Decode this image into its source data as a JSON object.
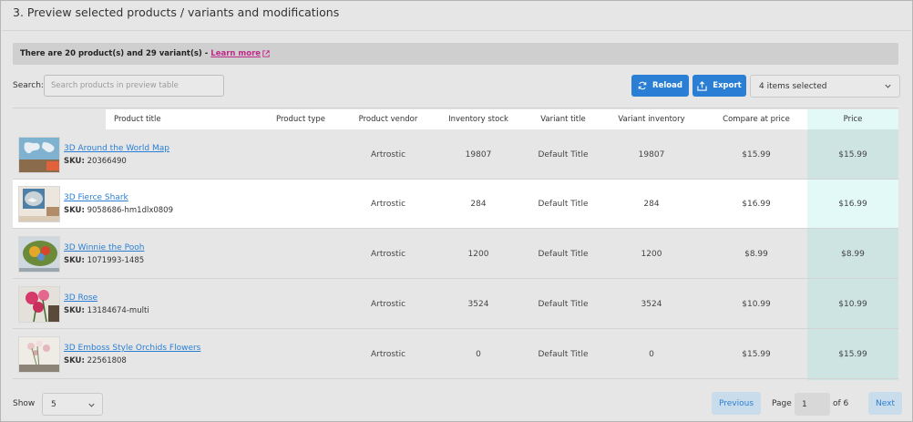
{
  "heading": "3. Preview selected products / variants and modifications",
  "info": {
    "text": "There are 20 product(s) and 29 variant(s) -",
    "learn_more": "Learn more"
  },
  "search": {
    "label": "Search:",
    "placeholder": "Search products in preview table"
  },
  "toolbar": {
    "reload_label": "Reload",
    "export_label": "Export",
    "columns_select": "4 items selected"
  },
  "columns": {
    "product_title": "Product title",
    "product_type": "Product type",
    "product_vendor": "Product vendor",
    "inventory_stock": "Inventory stock",
    "variant_title": "Variant title",
    "variant_inventory": "Variant inventory",
    "compare_at_price": "Compare at price",
    "price": "Price"
  },
  "rows": [
    {
      "title": "3D Around the World Map",
      "sku_label": "SKU:",
      "sku": "20366490",
      "vendor": "Artrostic",
      "stock": "19807",
      "variant": "Default Title",
      "variant_inventory": "19807",
      "compare": "$15.99",
      "price": "$15.99"
    },
    {
      "title": "3D Fierce Shark",
      "sku_label": "SKU:",
      "sku": "9058686-hm1dlx0809",
      "vendor": "Artrostic",
      "stock": "284",
      "variant": "Default Title",
      "variant_inventory": "284",
      "compare": "$16.99",
      "price": "$16.99"
    },
    {
      "title": "3D Winnie the Pooh",
      "sku_label": "SKU:",
      "sku": "1071993-1485",
      "vendor": "Artrostic",
      "stock": "1200",
      "variant": "Default Title",
      "variant_inventory": "1200",
      "compare": "$8.99",
      "price": "$8.99"
    },
    {
      "title": "3D Rose",
      "sku_label": "SKU:",
      "sku": "13184674-multi",
      "vendor": "Artrostic",
      "stock": "3524",
      "variant": "Default Title",
      "variant_inventory": "3524",
      "compare": "$10.99",
      "price": "$10.99"
    },
    {
      "title": "3D Emboss Style Orchids Flowers",
      "sku_label": "SKU:",
      "sku": "22561808",
      "vendor": "Artrostic",
      "stock": "0",
      "variant": "Default Title",
      "variant_inventory": "0",
      "compare": "$15.99",
      "price": "$15.99"
    }
  ],
  "pagination": {
    "show_label": "Show",
    "page_size": "5",
    "previous": "Previous",
    "page_label": "Page",
    "page": "1",
    "of": "of 6",
    "next": "Next"
  },
  "colors": {
    "accent": "#2a7fd4",
    "link": "#c0288b",
    "price_column": "#cde4e3"
  }
}
